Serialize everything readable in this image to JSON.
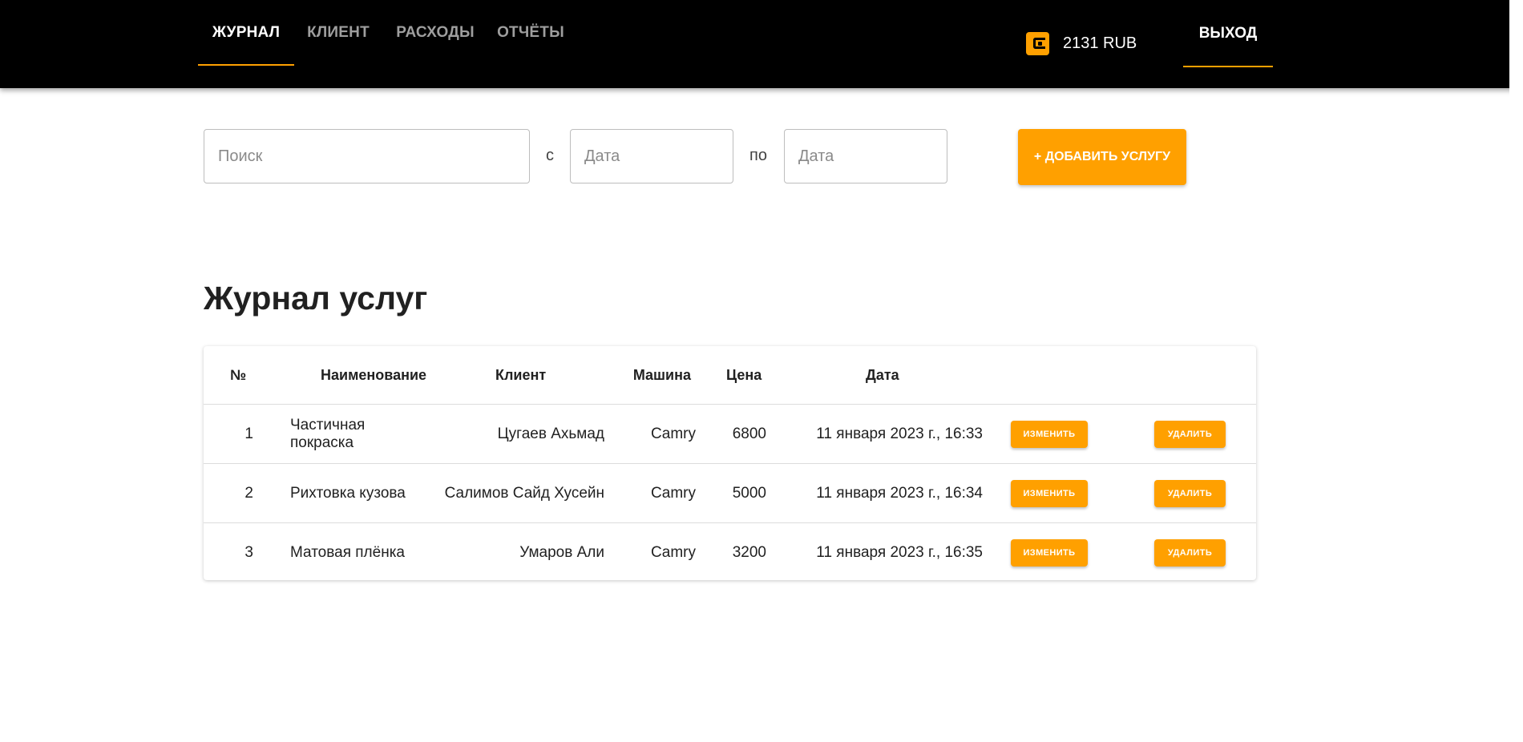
{
  "nav": {
    "tabs": [
      {
        "label": "ЖУРНАЛ",
        "active": true
      },
      {
        "label": "КЛИЕНТ",
        "active": false
      },
      {
        "label": "РАСХОДЫ",
        "active": false
      },
      {
        "label": "ОТЧЁТЫ",
        "active": false
      }
    ],
    "wallet_icon": "wallet-icon",
    "balance": "2131 RUB",
    "logout_label": "ВЫХОД"
  },
  "filters": {
    "search_placeholder": "Поиск",
    "from_label": "с",
    "date_from_placeholder": "Дата",
    "to_label": "по",
    "date_to_placeholder": "Дата",
    "add_button": "+ ДОБАВИТЬ УСЛУГУ"
  },
  "journal": {
    "title": "Журнал услуг",
    "columns": [
      "№",
      "Наименование",
      "Клиент",
      "Машина",
      "Цена",
      "Дата"
    ],
    "edit_label": "ИЗМЕНИТЬ",
    "delete_label": "УДАЛИТЬ",
    "rows": [
      {
        "num": "1",
        "name": "Частичная покраска",
        "client": "Цугаев Ахьмад",
        "car": "Camry",
        "price": "6800",
        "date": "11 января 2023 г., 16:33"
      },
      {
        "num": "2",
        "name": "Рихтовка кузова",
        "client": "Салимов Сайд Хусейн",
        "car": "Camry",
        "price": "5000",
        "date": "11 января 2023 г., 16:34"
      },
      {
        "num": "3",
        "name": "Матовая плёнка",
        "client": "Умаров Али",
        "car": "Camry",
        "price": "3200",
        "date": "11 января 2023 г., 16:35"
      }
    ]
  },
  "colors": {
    "accent": "#ffa000",
    "header_bg": "#000000"
  }
}
